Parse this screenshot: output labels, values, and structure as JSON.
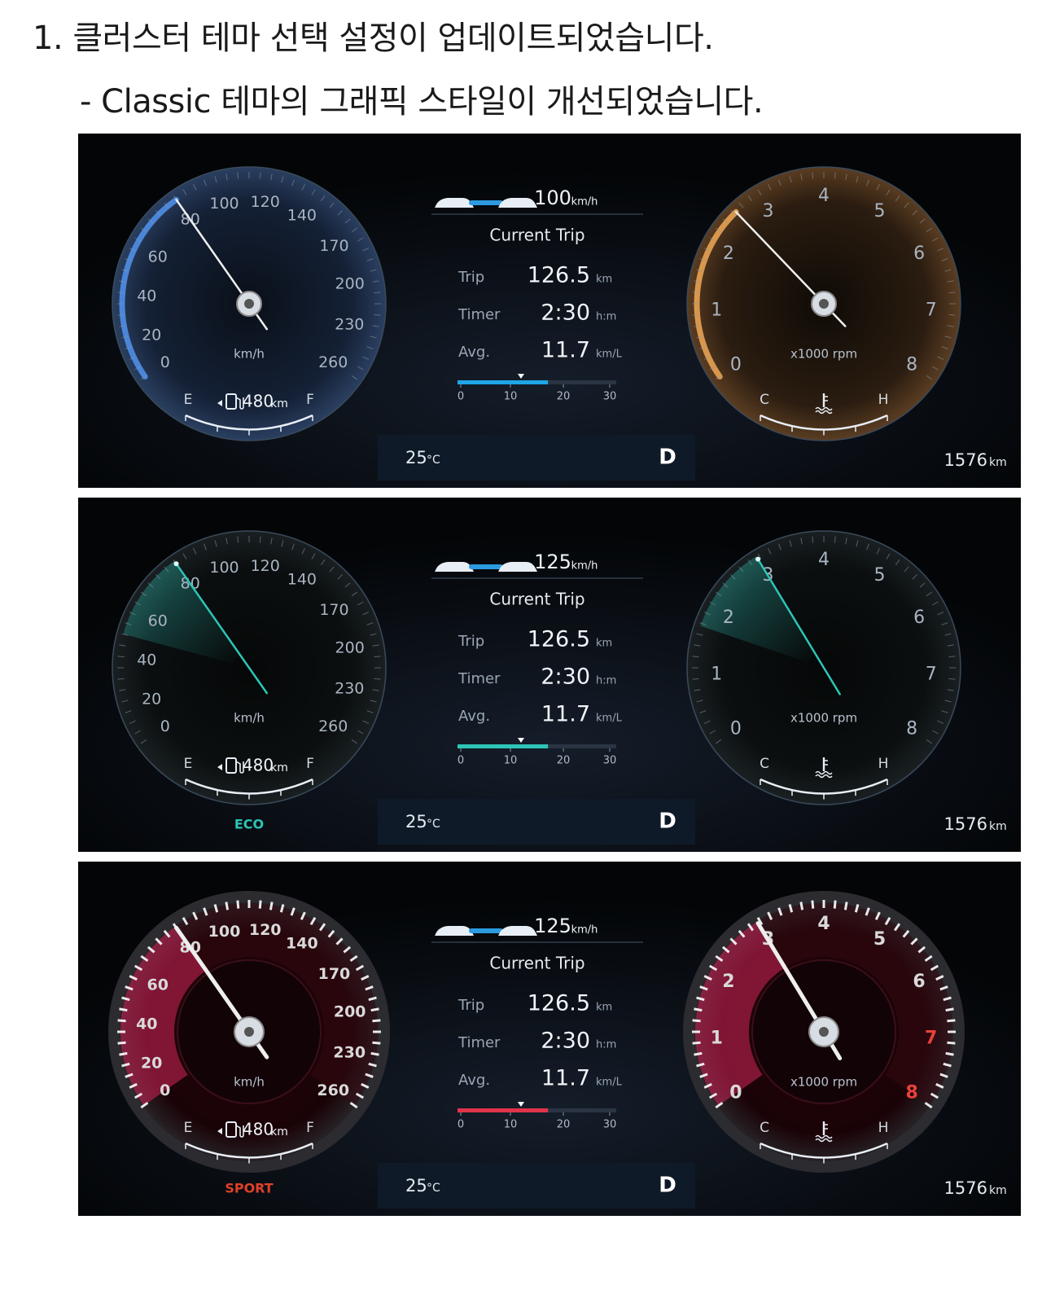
{
  "heading": "1. 클러스터 테마 선택 설정이 업데이트되었습니다.",
  "subheading": "- Classic 테마의 그래픽 스타일이 개선되었습니다.",
  "panels": [
    {
      "theme": "classic",
      "accent": "#4f8ee6",
      "rpm_accent": "#e8a253",
      "speed_value": 80,
      "rpm_value": 2.6,
      "mode_label": "",
      "speed_ticks": [
        "0",
        "20",
        "40",
        "60",
        "80",
        "100",
        "120",
        "140",
        "170",
        "200",
        "230",
        "260"
      ],
      "rpm_ticks": [
        "0",
        "1",
        "2",
        "3",
        "4",
        "5",
        "6",
        "7",
        "8"
      ],
      "speed_unit": "km/h",
      "rpm_unit": "x1000 rpm",
      "fuel_e": "E",
      "fuel_f": "F",
      "fuel_range": "480",
      "fuel_range_unit": "km",
      "temp_c": "C",
      "temp_h": "H",
      "cruise_speed": "100",
      "cruise_unit": "km/h",
      "trip_title": "Current Trip",
      "trip_label": "Trip",
      "trip_value": "126.5",
      "trip_unit": "km",
      "timer_label": "Timer",
      "timer_value": "2:30",
      "timer_unit": "h:m",
      "avg_label": "Avg.",
      "avg_value": "11.7",
      "avg_unit": "km/L",
      "avg_fill": 0.57,
      "avg_marker": 0.4,
      "bar_ticks": [
        "0",
        "10",
        "20",
        "30"
      ],
      "outside_temp": "25",
      "outside_temp_unit": "°C",
      "gear": "D",
      "odometer": "1576",
      "odometer_unit": "km"
    },
    {
      "theme": "eco",
      "accent": "#2ec4b6",
      "rpm_accent": "#2ec4b6",
      "speed_value": 80,
      "rpm_value": 3,
      "mode_label": "ECO",
      "mode_color": "#2ec4b6",
      "speed_ticks": [
        "0",
        "20",
        "40",
        "60",
        "80",
        "100",
        "120",
        "140",
        "170",
        "200",
        "230",
        "260"
      ],
      "rpm_ticks": [
        "0",
        "1",
        "2",
        "3",
        "4",
        "5",
        "6",
        "7",
        "8"
      ],
      "speed_unit": "km/h",
      "rpm_unit": "x1000 rpm",
      "fuel_e": "E",
      "fuel_f": "F",
      "fuel_range": "480",
      "fuel_range_unit": "km",
      "temp_c": "C",
      "temp_h": "H",
      "cruise_speed": "125",
      "cruise_unit": "km/h",
      "trip_title": "Current Trip",
      "trip_label": "Trip",
      "trip_value": "126.5",
      "trip_unit": "km",
      "timer_label": "Timer",
      "timer_value": "2:30",
      "timer_unit": "h:m",
      "avg_label": "Avg.",
      "avg_value": "11.7",
      "avg_unit": "km/L",
      "avg_fill": 0.57,
      "avg_marker": 0.4,
      "bar_ticks": [
        "0",
        "10",
        "20",
        "30"
      ],
      "outside_temp": "25",
      "outside_temp_unit": "°C",
      "gear": "D",
      "odometer": "1576",
      "odometer_unit": "km"
    },
    {
      "theme": "sport",
      "accent": "#d4245a",
      "rpm_accent": "#d4245a",
      "speed_value": 80,
      "rpm_value": 3,
      "mode_label": "SPORT",
      "mode_color": "#e0402a",
      "speed_ticks": [
        "0",
        "20",
        "40",
        "60",
        "80",
        "100",
        "120",
        "140",
        "170",
        "200",
        "230",
        "260"
      ],
      "rpm_ticks": [
        "0",
        "1",
        "2",
        "3",
        "4",
        "5",
        "6",
        "7",
        "8"
      ],
      "speed_unit": "km/h",
      "rpm_unit": "x1000 rpm",
      "fuel_e": "E",
      "fuel_f": "F",
      "fuel_range": "480",
      "fuel_range_unit": "km",
      "temp_c": "C",
      "temp_h": "H",
      "cruise_speed": "125",
      "cruise_unit": "km/h",
      "trip_title": "Current Trip",
      "trip_label": "Trip",
      "trip_value": "126.5",
      "trip_unit": "km",
      "timer_label": "Timer",
      "timer_value": "2:30",
      "timer_unit": "h:m",
      "avg_label": "Avg.",
      "avg_value": "11.7",
      "avg_unit": "km/L",
      "avg_fill": 0.57,
      "avg_marker": 0.4,
      "bar_ticks": [
        "0",
        "10",
        "20",
        "30"
      ],
      "outside_temp": "25",
      "outside_temp_unit": "°C",
      "gear": "D",
      "odometer": "1576",
      "odometer_unit": "km"
    }
  ]
}
